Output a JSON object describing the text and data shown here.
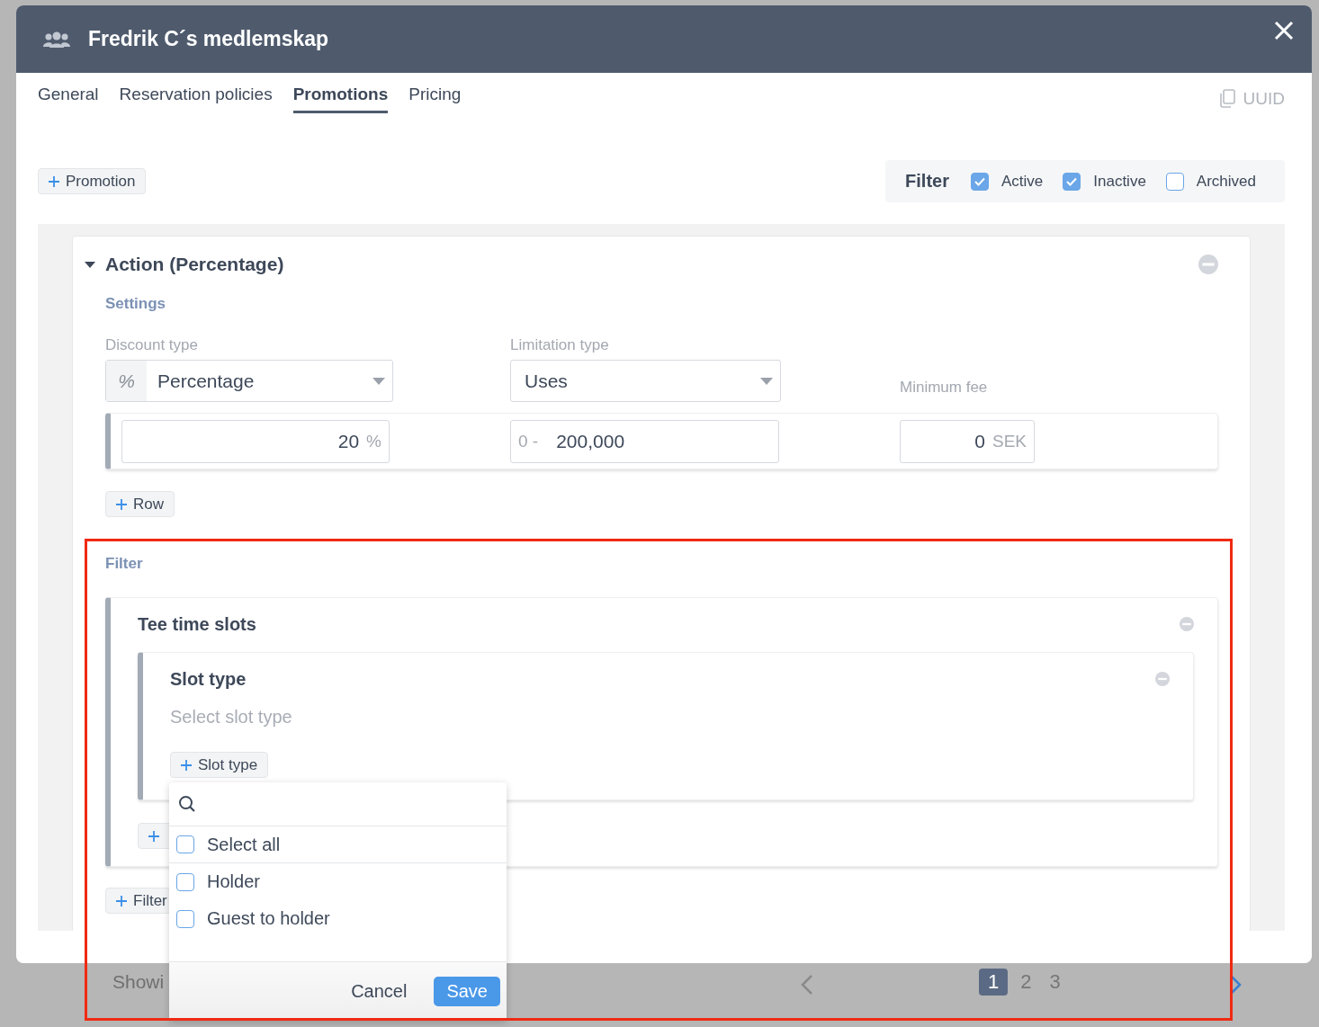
{
  "backdrop": {
    "footer_text": "Showi",
    "pagination": {
      "pages": [
        {
          "label": "1",
          "selected": true
        },
        {
          "label": "2",
          "selected": false
        },
        {
          "label": "3",
          "selected": false
        }
      ]
    }
  },
  "modal": {
    "title": "Fredrik C´s medlemskap",
    "uuid_label": "UUID",
    "tabs": [
      {
        "label": "General",
        "selected": false
      },
      {
        "label": "Reservation policies",
        "selected": false
      },
      {
        "label": "Promotions",
        "selected": true
      },
      {
        "label": "Pricing",
        "selected": false
      }
    ]
  },
  "add_promotion_button": "Promotion",
  "status_filter": {
    "label": "Filter",
    "options": [
      {
        "label": "Active",
        "checked": true
      },
      {
        "label": "Inactive",
        "checked": true
      },
      {
        "label": "Archived",
        "checked": false
      }
    ]
  },
  "action": {
    "title": "Action (Percentage)",
    "expanded": true,
    "settings_label": "Settings",
    "discount_type": {
      "label": "Discount type",
      "prefix": "%",
      "value": "Percentage"
    },
    "limitation_type": {
      "label": "Limitation type",
      "value": "Uses"
    },
    "minimum_fee": {
      "label": "Minimum fee"
    },
    "row": {
      "percent": {
        "value": "20",
        "unit": "%"
      },
      "range": {
        "prefix": "0 -",
        "value": "200,000"
      },
      "fee": {
        "value": "0",
        "unit": "SEK"
      }
    },
    "add_row_button": "Row",
    "filter_label": "Filter",
    "group": {
      "title": "Tee time slots",
      "condition": {
        "title": "Slot type",
        "placeholder": "Select slot type",
        "add_button": "Slot type"
      }
    },
    "add_filter_button": "Filter"
  },
  "dropdown": {
    "options": [
      {
        "label": "Select all",
        "checked": false
      },
      {
        "label": "Holder",
        "checked": false
      },
      {
        "label": "Guest to holder",
        "checked": false
      }
    ],
    "cancel_button": "Cancel",
    "save_button": "Save"
  }
}
